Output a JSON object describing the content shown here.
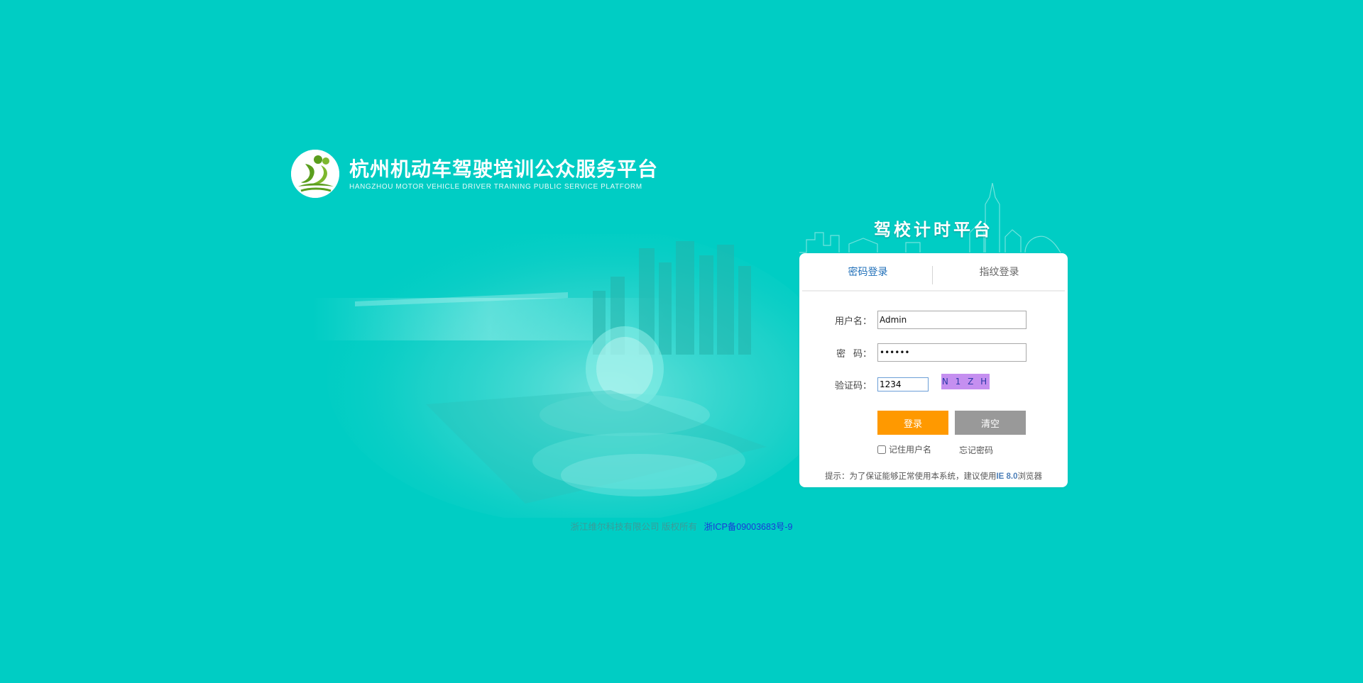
{
  "brand": {
    "title": "杭州机动车驾驶培训公众服务平台",
    "subtitle": "HANGZHOU MOTOR VEHICLE DRIVER TRAINING PUBLIC SERVICE PLATFORM",
    "logo_icon": "driver-logo-icon"
  },
  "platform": {
    "title": "驾校计时平台"
  },
  "tabs": [
    {
      "label": "密码登录",
      "active": true
    },
    {
      "label": "指纹登录",
      "active": false
    }
  ],
  "form": {
    "username_label": "用户名：",
    "username_value": "Admin",
    "password_label": "密   码：",
    "password_value": "••••••",
    "captcha_label": "验证码：",
    "captcha_value": "1234",
    "captcha_image_text": "N 1 Z H",
    "login_button": "登录",
    "clear_button": "清空",
    "remember_label": "记住用户名",
    "remember_checked": false,
    "forgot_link": "忘记密码",
    "hint_prefix": "提示：为了保证能够正常使用本系统，建议使用",
    "hint_browser": "IE 8.0",
    "hint_suffix": "浏览器"
  },
  "footer": {
    "copyright": "浙江维尔科技有限公司 版权所有",
    "icp": "浙ICP备09003683号-9"
  },
  "colors": {
    "background": "#00cdc4",
    "accent_tab": "#1f6fb8",
    "login_button": "#ff9900",
    "clear_button": "#999999",
    "captcha_bg": "#c58ff0",
    "logo_green": "#5a9e1e"
  }
}
